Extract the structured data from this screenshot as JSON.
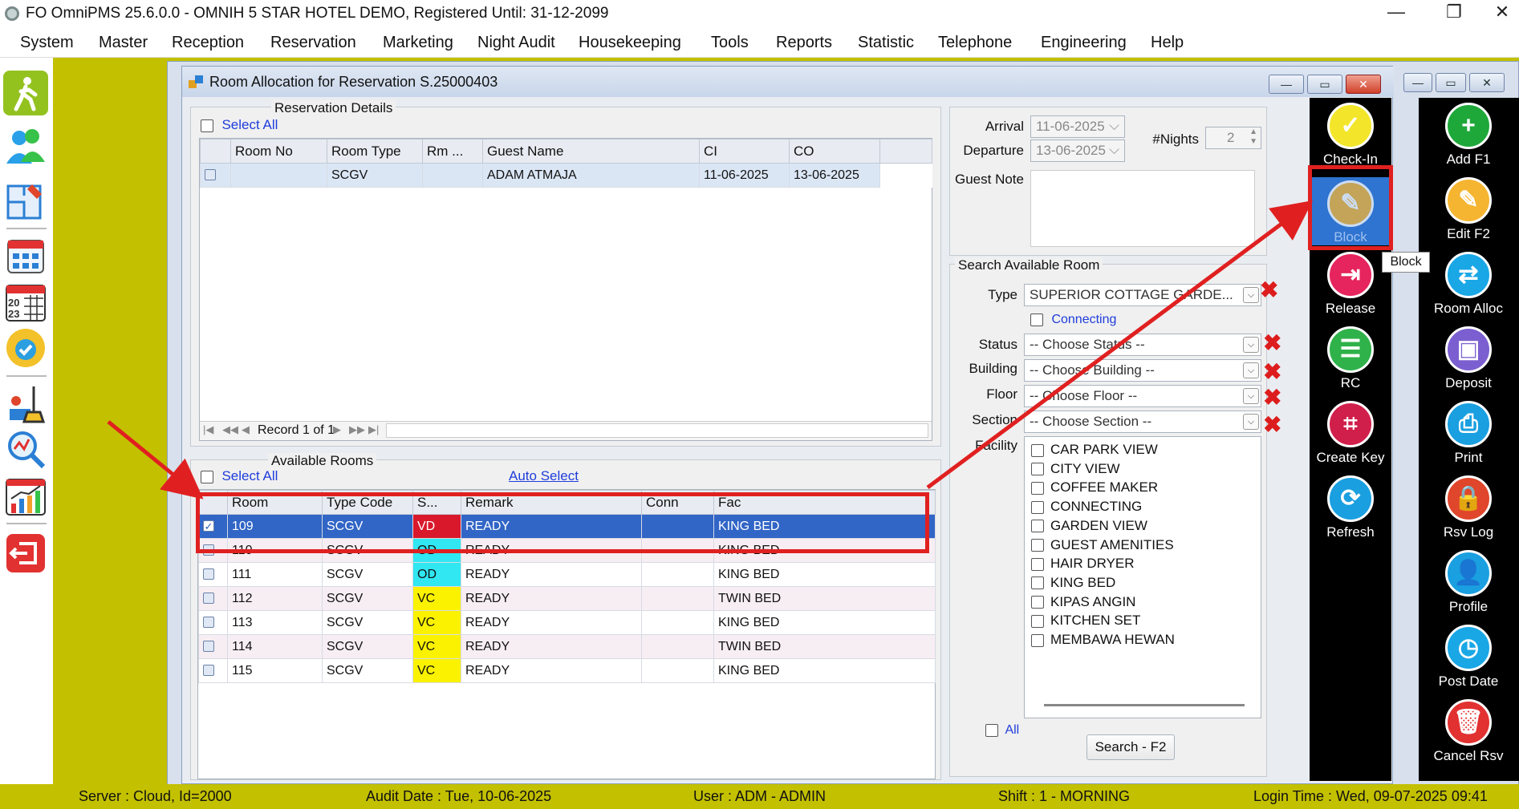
{
  "app": {
    "title": "FO OmniPMS 25.6.0.0 - OMNIH 5 STAR HOTEL DEMO, Registered Until: 31-12-2099"
  },
  "menu": [
    "System",
    "Master",
    "Reception",
    "Reservation",
    "Marketing",
    "Night Audit",
    "Housekeeping",
    "Tools",
    "Reports",
    "Statistic",
    "Telephone",
    "Engineering",
    "Help"
  ],
  "window": {
    "title": "Room Allocation for Reservation S.25000403"
  },
  "reservation_details": {
    "legend": "Reservation Details",
    "select_all": "Select All",
    "columns": [
      "Room No",
      "Room Type",
      "Rm ...",
      "Guest Name",
      "CI",
      "CO"
    ],
    "rows": [
      {
        "room_no": "",
        "room_type": "SCGV",
        "rm": "",
        "guest_name": "ADAM ATMAJA",
        "ci": "11-06-2025",
        "co": "13-06-2025"
      }
    ],
    "record_nav": "Record 1 of 1"
  },
  "available_rooms": {
    "legend": "Available Rooms",
    "select_all": "Select All",
    "auto_select": "Auto Select",
    "columns": [
      "Room",
      "Type Code",
      "S...",
      "Remark",
      "Conn",
      "Fac"
    ],
    "rows": [
      {
        "room": "109",
        "type": "SCGV",
        "status": "VD",
        "remark": "READY",
        "conn": "",
        "fac": "KING BED",
        "checked": true
      },
      {
        "room": "110",
        "type": "SCGV",
        "status": "OD",
        "remark": "READY",
        "conn": "",
        "fac": "KING BED",
        "checked": false
      },
      {
        "room": "111",
        "type": "SCGV",
        "status": "OD",
        "remark": "READY",
        "conn": "",
        "fac": "KING BED",
        "checked": false
      },
      {
        "room": "112",
        "type": "SCGV",
        "status": "VC",
        "remark": "READY",
        "conn": "",
        "fac": "TWIN BED",
        "checked": false
      },
      {
        "room": "113",
        "type": "SCGV",
        "status": "VC",
        "remark": "READY",
        "conn": "",
        "fac": "KING BED",
        "checked": false
      },
      {
        "room": "114",
        "type": "SCGV",
        "status": "VC",
        "remark": "READY",
        "conn": "",
        "fac": "TWIN BED",
        "checked": false
      },
      {
        "room": "115",
        "type": "SCGV",
        "status": "VC",
        "remark": "READY",
        "conn": "",
        "fac": "KING BED",
        "checked": false
      }
    ]
  },
  "stay": {
    "arrival_label": "Arrival",
    "arrival": "11-06-2025",
    "departure_label": "Departure",
    "departure": "13-06-2025",
    "nights_label": "#Nights",
    "nights": "2",
    "guest_note_label": "Guest Note"
  },
  "search": {
    "legend": "Search Available Room",
    "type_label": "Type",
    "type_value": "SUPERIOR COTTAGE GARDE...",
    "connecting": "Connecting",
    "status_label": "Status",
    "status_value": "-- Choose Status --",
    "building_label": "Building",
    "building_value": "-- Choose Building --",
    "floor_label": "Floor",
    "floor_value": "-- Choose Floor --",
    "section_label": "Section",
    "section_value": "-- Choose Section --",
    "facility_label": "Facility",
    "facilities": [
      "CAR PARK VIEW",
      "CITY VIEW",
      "COFFEE MAKER",
      "CONNECTING",
      "GARDEN VIEW",
      "GUEST AMENITIES",
      "HAIR DRYER",
      "KING BED",
      "KIPAS ANGIN",
      "KITCHEN SET",
      "MEMBAWA HEWAN"
    ],
    "all_label": "All",
    "search_button": "Search - F2"
  },
  "actions_left": [
    {
      "label": "Check-In",
      "icon": "checkmark-icon",
      "color": "#f3e62a"
    },
    {
      "label": "Block",
      "icon": "edit-icon",
      "color": "#f5b531"
    },
    {
      "label": "Release",
      "icon": "exit-icon",
      "color": "#e6245d"
    },
    {
      "label": "RC",
      "icon": "receipt-icon",
      "color": "#2fb24a"
    },
    {
      "label": "Create Key",
      "icon": "keycard-icon",
      "color": "#d11f4b"
    },
    {
      "label": "Refresh",
      "icon": "refresh-icon",
      "color": "#1a9fe0"
    }
  ],
  "tooltip": "Block",
  "actions_right": [
    {
      "label": "Add F1",
      "icon": "plus-icon",
      "color": "#1fa83a"
    },
    {
      "label": "Edit F2",
      "icon": "edit-icon",
      "color": "#f5b531"
    },
    {
      "label": "Room Alloc",
      "icon": "swap-arrows-icon",
      "color": "#19a7e6"
    },
    {
      "label": "Deposit",
      "icon": "wallet-icon",
      "color": "#7b5fd0"
    },
    {
      "label": "Print",
      "icon": "printer-icon",
      "color": "#1a9fe0"
    },
    {
      "label": "Rsv Log",
      "icon": "lock-icon",
      "color": "#e0462b"
    },
    {
      "label": "Profile",
      "icon": "user-icon",
      "color": "#1a9fe0"
    },
    {
      "label": "Post Date",
      "icon": "clock-icon",
      "color": "#19a7e6"
    },
    {
      "label": "Cancel Rsv",
      "icon": "trash-icon",
      "color": "#e23131"
    }
  ],
  "statusbar": {
    "server": "Server : Cloud, Id=2000",
    "audit": "Audit Date : Tue, 10-06-2025",
    "user": "User : ADM - ADMIN",
    "shift": "Shift : 1 - MORNING",
    "login": "Login Time : Wed, 09-07-2025 09:41"
  },
  "colors": {
    "olive": "#c3c000",
    "highlight_red": "#e02020",
    "selected_row": "#3165c6"
  }
}
